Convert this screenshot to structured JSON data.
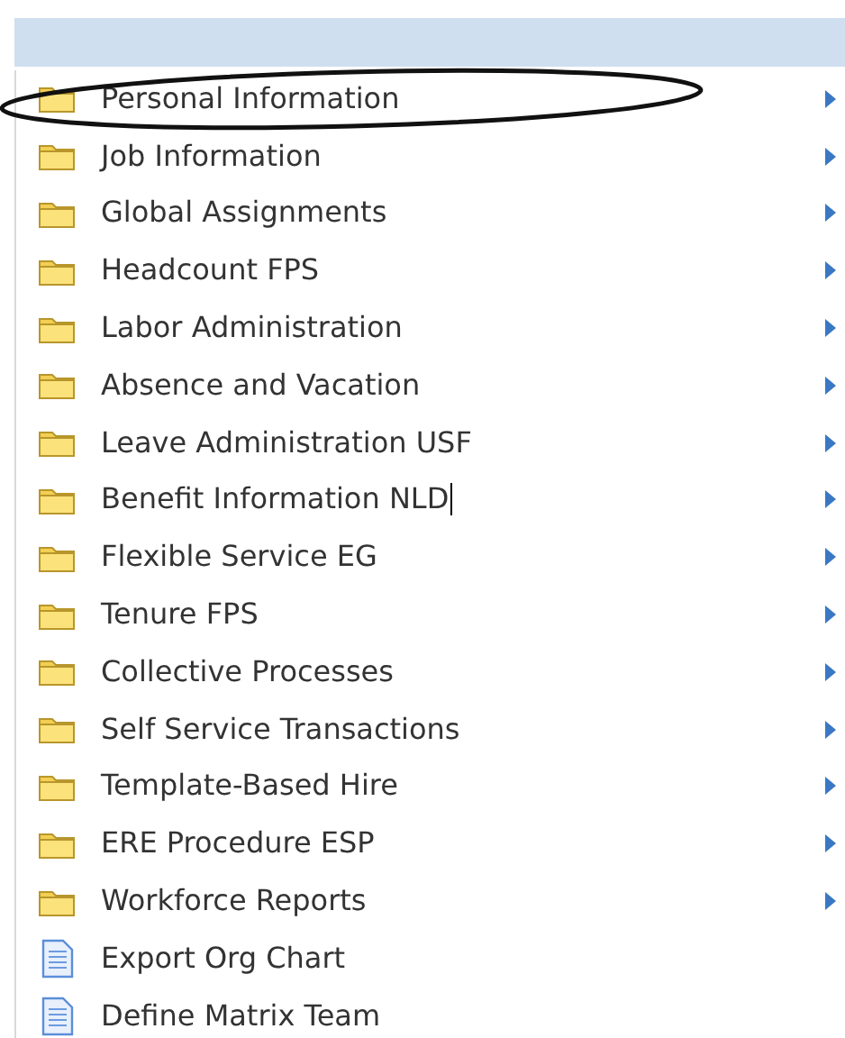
{
  "items": [
    {
      "label": "Personal Information",
      "kind": "folder",
      "submenu": true,
      "circled": true,
      "text_cursor": false
    },
    {
      "label": "Job Information",
      "kind": "folder",
      "submenu": true,
      "circled": false,
      "text_cursor": false
    },
    {
      "label": "Global Assignments",
      "kind": "folder",
      "submenu": true,
      "circled": false,
      "text_cursor": false
    },
    {
      "label": "Headcount FPS",
      "kind": "folder",
      "submenu": true,
      "circled": false,
      "text_cursor": false
    },
    {
      "label": "Labor Administration",
      "kind": "folder",
      "submenu": true,
      "circled": false,
      "text_cursor": false
    },
    {
      "label": "Absence and Vacation",
      "kind": "folder",
      "submenu": true,
      "circled": false,
      "text_cursor": false
    },
    {
      "label": "Leave Administration USF",
      "kind": "folder",
      "submenu": true,
      "circled": false,
      "text_cursor": false
    },
    {
      "label": "Benefit Information NLD",
      "kind": "folder",
      "submenu": true,
      "circled": false,
      "text_cursor": true
    },
    {
      "label": "Flexible Service EG",
      "kind": "folder",
      "submenu": true,
      "circled": false,
      "text_cursor": false
    },
    {
      "label": "Tenure FPS",
      "kind": "folder",
      "submenu": true,
      "circled": false,
      "text_cursor": false
    },
    {
      "label": "Collective Processes",
      "kind": "folder",
      "submenu": true,
      "circled": false,
      "text_cursor": false
    },
    {
      "label": "Self Service Transactions",
      "kind": "folder",
      "submenu": true,
      "circled": false,
      "text_cursor": false
    },
    {
      "label": "Template-Based Hire",
      "kind": "folder",
      "submenu": true,
      "circled": false,
      "text_cursor": false
    },
    {
      "label": "ERE Procedure ESP",
      "kind": "folder",
      "submenu": true,
      "circled": false,
      "text_cursor": false
    },
    {
      "label": "Workforce Reports",
      "kind": "folder",
      "submenu": true,
      "circled": false,
      "text_cursor": false
    },
    {
      "label": "Export Org Chart",
      "kind": "document",
      "submenu": false,
      "circled": false,
      "text_cursor": false
    },
    {
      "label": "Define Matrix Team",
      "kind": "document",
      "submenu": false,
      "circled": false,
      "text_cursor": false
    }
  ]
}
